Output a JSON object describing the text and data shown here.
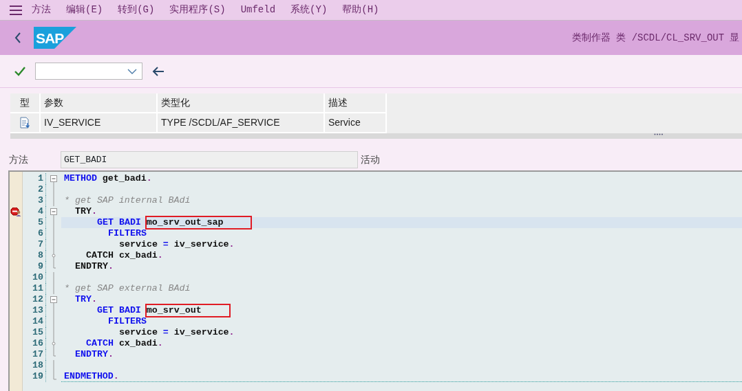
{
  "menu": [
    {
      "label": "方法"
    },
    {
      "label": "编辑(E)"
    },
    {
      "label": "转到(G)"
    },
    {
      "label": "实用程序(S)"
    },
    {
      "label": "Umfeld"
    },
    {
      "label": "系统(Y)"
    },
    {
      "label": "帮助(H)"
    }
  ],
  "header": {
    "logo": "SAP",
    "title": "类制作器 类 /SCDL/CL_SRV_OUT 显"
  },
  "params": {
    "columns": [
      "型",
      "参数",
      "类型化",
      "描述"
    ],
    "rows": [
      {
        "parameter": "IV_SERVICE",
        "typing": "TYPE /SCDL/AF_SERVICE",
        "description": "Service"
      }
    ]
  },
  "method": {
    "label": "方法",
    "value": "GET_BADI",
    "status": "活动"
  },
  "code": [
    {
      "number": "1",
      "kind": "fold_open",
      "breakpoint": false,
      "selected": false,
      "tokens": [
        {
          "kind": "keyword",
          "text": "METHOD"
        },
        {
          "kind": "text",
          "text": " get_badi"
        },
        {
          "kind": "period",
          "text": "."
        }
      ]
    },
    {
      "number": "2",
      "kind": "inside",
      "breakpoint": false,
      "selected": false
    },
    {
      "number": "3",
      "kind": "inside",
      "breakpoint": false,
      "selected": false,
      "tokens": [
        {
          "kind": "comment",
          "text": "* get SAP internal BAdi"
        }
      ]
    },
    {
      "number": "4",
      "kind": "fold_open",
      "breakpoint": true,
      "selected": false,
      "tokens": [
        {
          "kind": "statement",
          "text": "  TRY"
        },
        {
          "kind": "period",
          "text": "."
        }
      ]
    },
    {
      "number": "5",
      "kind": "inside",
      "breakpoint": false,
      "selected": true,
      "tokens": [
        {
          "kind": "keyword",
          "text": "      GET BADI "
        },
        {
          "kind": "text",
          "text": "mo_srv_out_sap",
          "boxed": true
        }
      ]
    },
    {
      "number": "6",
      "kind": "inside",
      "breakpoint": false,
      "selected": false,
      "tokens": [
        {
          "kind": "keyword",
          "text": "        FILTERS"
        }
      ]
    },
    {
      "number": "7",
      "kind": "inside",
      "breakpoint": false,
      "selected": false,
      "tokens": [
        {
          "kind": "text",
          "text": "          service "
        },
        {
          "kind": "keyword",
          "text": "="
        },
        {
          "kind": "text",
          "text": " iv_service"
        },
        {
          "kind": "period",
          "text": "."
        }
      ]
    },
    {
      "number": "8",
      "kind": "fold_branch",
      "breakpoint": false,
      "selected": false,
      "tokens": [
        {
          "kind": "statement",
          "text": "    CATCH"
        },
        {
          "kind": "text",
          "text": " cx_badi"
        },
        {
          "kind": "period",
          "text": "."
        }
      ]
    },
    {
      "number": "9",
      "kind": "fold_end",
      "breakpoint": false,
      "selected": false,
      "tokens": [
        {
          "kind": "statement",
          "text": "  ENDTRY"
        },
        {
          "kind": "period",
          "text": "."
        }
      ]
    },
    {
      "number": "10",
      "kind": "inside",
      "breakpoint": false,
      "selected": false
    },
    {
      "number": "11",
      "kind": "inside",
      "breakpoint": false,
      "selected": false,
      "tokens": [
        {
          "kind": "comment",
          "text": "* get SAP external BAdi"
        }
      ]
    },
    {
      "number": "12",
      "kind": "fold_open",
      "breakpoint": false,
      "selected": false,
      "tokens": [
        {
          "kind": "keyword",
          "text": "  TRY"
        },
        {
          "kind": "period",
          "text": "."
        }
      ]
    },
    {
      "number": "13",
      "kind": "inside",
      "breakpoint": false,
      "selected": false,
      "tokens": [
        {
          "kind": "keyword",
          "text": "      GET BADI "
        },
        {
          "kind": "text",
          "text": "mo_srv_out",
          "boxed": true
        }
      ]
    },
    {
      "number": "14",
      "kind": "inside",
      "breakpoint": false,
      "selected": false,
      "tokens": [
        {
          "kind": "keyword",
          "text": "        FILTERS"
        }
      ]
    },
    {
      "number": "15",
      "kind": "inside",
      "breakpoint": false,
      "selected": false,
      "tokens": [
        {
          "kind": "text",
          "text": "          service "
        },
        {
          "kind": "keyword",
          "text": "="
        },
        {
          "kind": "text",
          "text": " iv_service"
        },
        {
          "kind": "period",
          "text": "."
        }
      ]
    },
    {
      "number": "16",
      "kind": "fold_branch",
      "breakpoint": false,
      "selected": false,
      "tokens": [
        {
          "kind": "keyword",
          "text": "    CATCH"
        },
        {
          "kind": "text",
          "text": " cx_badi"
        },
        {
          "kind": "period",
          "text": "."
        }
      ]
    },
    {
      "number": "17",
      "kind": "fold_end",
      "breakpoint": false,
      "selected": false,
      "tokens": [
        {
          "kind": "keyword",
          "text": "  ENDTRY"
        },
        {
          "kind": "period",
          "text": "."
        }
      ]
    },
    {
      "number": "18",
      "kind": "inside",
      "breakpoint": false,
      "selected": false
    },
    {
      "number": "19",
      "kind": "fold_last",
      "breakpoint": false,
      "selected": false,
      "tokens": [
        {
          "kind": "keyword",
          "text": "ENDMETHOD"
        },
        {
          "kind": "period",
          "text": "."
        }
      ]
    }
  ]
}
